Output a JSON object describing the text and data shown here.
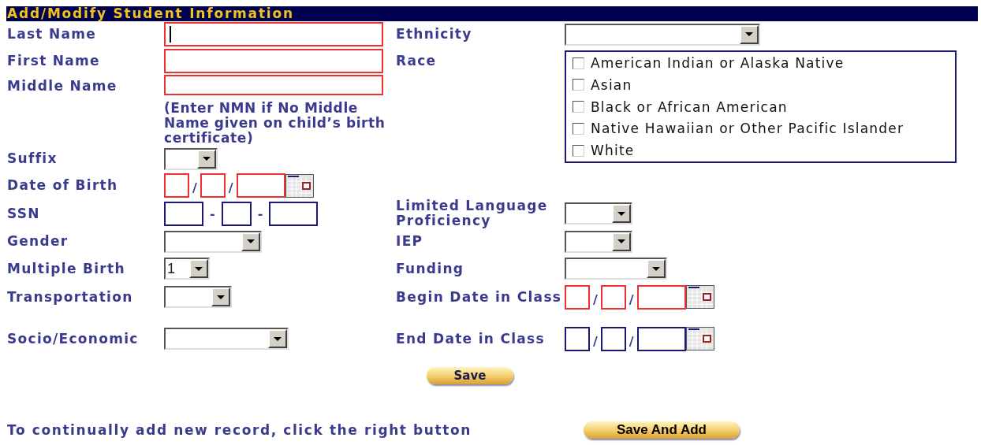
{
  "header": {
    "title": "Add/Modify Student Information"
  },
  "rows": [
    {
      "left": {
        "label": "Last Name",
        "kind": "text",
        "required": true,
        "focused": true
      },
      "right": {
        "label": "Ethnicity",
        "kind": "select"
      }
    },
    {
      "left": {
        "label": "First Name",
        "kind": "text",
        "required": true,
        "focused": false
      },
      "right": {
        "label": "Race",
        "kind": "checklist",
        "options": [
          {
            "label": "American Indian or Alaska Native",
            "checked": false
          },
          {
            "label": "Asian",
            "checked": false
          },
          {
            "label": "Black or African American",
            "checked": false
          },
          {
            "label": "Native Hawaiian or Other Pacific Islander",
            "checked": false
          },
          {
            "label": "White",
            "checked": false
          }
        ]
      }
    },
    {
      "left": {
        "label": "Middle Name",
        "kind": "text",
        "required": true,
        "focused": false,
        "hint": "(Enter NMN if No Middle Name given on child’s birth certificate)"
      }
    },
    {
      "left": {
        "label": "Suffix",
        "kind": "select"
      }
    },
    {
      "left": {
        "label": "Date of Birth",
        "kind": "date",
        "required": true,
        "separators": [
          "/",
          "/"
        ]
      }
    },
    {
      "left": {
        "label": "SSN",
        "kind": "ssn",
        "required": false,
        "separators": [
          "-",
          "-"
        ]
      },
      "right": {
        "label": "Limited Language Proficiency",
        "kind": "select"
      }
    },
    {
      "left": {
        "label": "Gender",
        "kind": "select"
      },
      "right": {
        "label": "IEP",
        "kind": "select"
      }
    },
    {
      "left": {
        "label": "Multiple Birth",
        "kind": "select",
        "value": "1"
      },
      "right": {
        "label": "Funding",
        "kind": "select"
      }
    },
    {
      "left": {
        "label": "Transportation",
        "kind": "select"
      },
      "right": {
        "label": "Begin Date in Class",
        "kind": "date",
        "required": true,
        "separators": [
          "/",
          "/"
        ]
      }
    },
    {
      "left": {
        "label": "Socio/Economic",
        "kind": "select"
      },
      "right": {
        "label": "End Date in Class",
        "kind": "date",
        "required": false,
        "separators": [
          "/",
          "/"
        ]
      }
    }
  ],
  "save_button": "Save",
  "footer": {
    "text": "To continually add new record, click the right button",
    "button": "Save And Add"
  }
}
